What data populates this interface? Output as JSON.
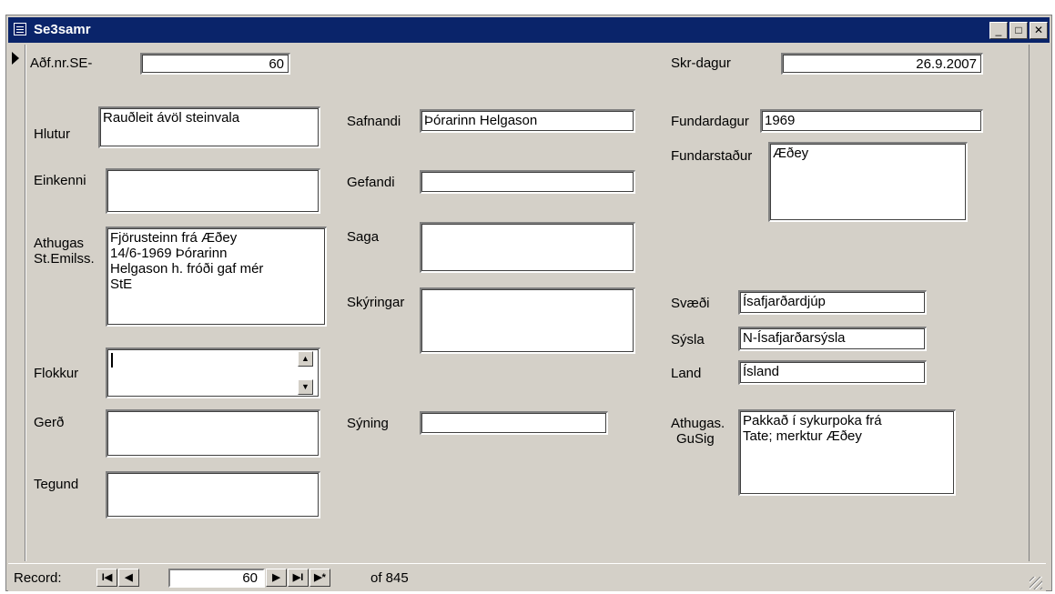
{
  "window": {
    "title": "Se3samr"
  },
  "fields": {
    "adfnr": {
      "label": "Aðf.nr.SE-",
      "value": "60"
    },
    "skrdagur": {
      "label": "Skr-dagur",
      "value": "26.9.2007"
    },
    "hlutur": {
      "label": "Hlutur",
      "value": "Rauðleit ávöl steinvala"
    },
    "safnandi": {
      "label": "Safnandi",
      "value": "Þórarinn Helgason"
    },
    "fundardagur": {
      "label": "Fundardagur",
      "value": "1969"
    },
    "fundarstadur": {
      "label": "Fundarstaður",
      "value": "Æðey"
    },
    "einkenni": {
      "label": "Einkenni",
      "value": ""
    },
    "gefandi": {
      "label": "Gefandi",
      "value": ""
    },
    "athugas_ste": {
      "label_line1": "Athugas",
      "label_line2": "St.Emilss.",
      "value": "Fjörusteinn frá Æðey\n14/6-1969 Þórarinn\nHelgason h. fróði gaf mér\nStE"
    },
    "saga": {
      "label": "Saga",
      "value": ""
    },
    "skyringar": {
      "label": "Skýringar",
      "value": ""
    },
    "svaedi": {
      "label": "Svæði",
      "value": "Ísafjarðardjúp"
    },
    "sysla": {
      "label": "Sýsla",
      "value": "N-Ísafjarðarsýsla"
    },
    "land": {
      "label": "Land",
      "value": "Ísland"
    },
    "flokkur": {
      "label": "Flokkur",
      "value": ""
    },
    "gerd": {
      "label": "Gerð",
      "value": ""
    },
    "syning": {
      "label": "Sýning",
      "value": ""
    },
    "athugas_gusig": {
      "label_line1": "Athugas.",
      "label_line2": "GuSig",
      "value": "Pakkað í sykurpoka frá\nTate; merktur Æðey"
    },
    "tegund": {
      "label": "Tegund",
      "value": ""
    }
  },
  "navigation": {
    "label": "Record:",
    "current": "60",
    "of_text": "of  845",
    "first_glyph": "I◀",
    "prev_glyph": "◀",
    "next_glyph": "▶",
    "last_glyph": "▶I",
    "new_glyph": "▶*"
  },
  "spin": {
    "up": "▲",
    "down": "▼"
  },
  "title_buttons": {
    "minimize": "_",
    "maximize": "□",
    "close": "✕"
  }
}
